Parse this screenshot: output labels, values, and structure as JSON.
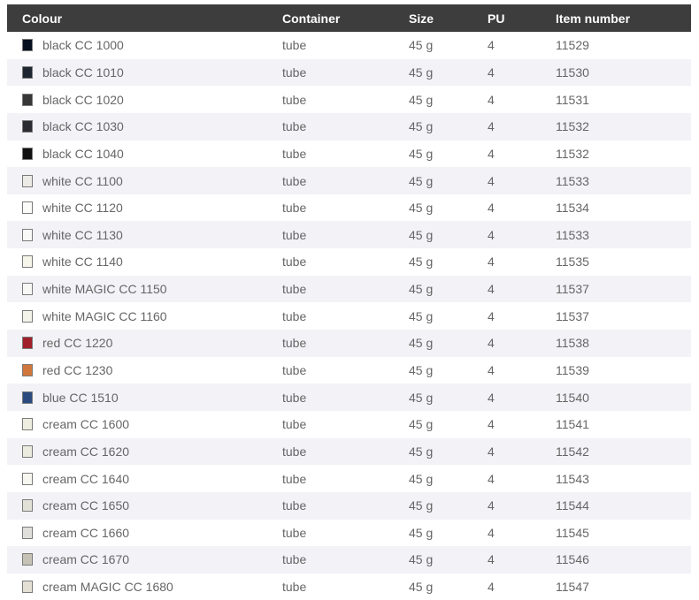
{
  "header": {
    "colour": "Colour",
    "container": "Container",
    "size": "Size",
    "pu": "PU",
    "item_number": "Item number"
  },
  "rows": [
    {
      "colour": "black CC 1000",
      "swatch": "#07101e",
      "container": "tube",
      "size": "45 g",
      "pu": "4",
      "item": "11529"
    },
    {
      "colour": "black CC 1010",
      "swatch": "#1d2630",
      "container": "tube",
      "size": "45 g",
      "pu": "4",
      "item": "11530"
    },
    {
      "colour": "black CC 1020",
      "swatch": "#373737",
      "container": "tube",
      "size": "45 g",
      "pu": "4",
      "item": "11531"
    },
    {
      "colour": "black CC 1030",
      "swatch": "#2a2a31",
      "container": "tube",
      "size": "45 g",
      "pu": "4",
      "item": "11532"
    },
    {
      "colour": "black CC 1040",
      "swatch": "#111111",
      "container": "tube",
      "size": "45 g",
      "pu": "4",
      "item": "11532"
    },
    {
      "colour": "white CC 1100",
      "swatch": "#ecebe6",
      "container": "tube",
      "size": "45 g",
      "pu": "4",
      "item": "11533"
    },
    {
      "colour": "white CC 1120",
      "swatch": "#fbfbfa",
      "container": "tube",
      "size": "45 g",
      "pu": "4",
      "item": "11534"
    },
    {
      "colour": "white CC 1130",
      "swatch": "#f9f9f7",
      "container": "tube",
      "size": "45 g",
      "pu": "4",
      "item": "11533"
    },
    {
      "colour": "white CC 1140",
      "swatch": "#f6f6ea",
      "container": "tube",
      "size": "45 g",
      "pu": "4",
      "item": "11535"
    },
    {
      "colour": "white MAGIC CC 1150",
      "swatch": "#f8f8f6",
      "container": "tube",
      "size": "45 g",
      "pu": "4",
      "item": "11537"
    },
    {
      "colour": "white MAGIC CC 1160",
      "swatch": "#f3f3ea",
      "container": "tube",
      "size": "45 g",
      "pu": "4",
      "item": "11537"
    },
    {
      "colour": "red CC 1220",
      "swatch": "#a01f2b",
      "container": "tube",
      "size": "45 g",
      "pu": "4",
      "item": "11538"
    },
    {
      "colour": "red CC 1230",
      "swatch": "#d2773b",
      "container": "tube",
      "size": "45 g",
      "pu": "4",
      "item": "11539"
    },
    {
      "colour": "blue CC 1510",
      "swatch": "#2b4a7e",
      "container": "tube",
      "size": "45 g",
      "pu": "4",
      "item": "11540"
    },
    {
      "colour": "cream CC 1600",
      "swatch": "#eeeee0",
      "container": "tube",
      "size": "45 g",
      "pu": "4",
      "item": "11541"
    },
    {
      "colour": "cream CC 1620",
      "swatch": "#ebebe0",
      "container": "tube",
      "size": "45 g",
      "pu": "4",
      "item": "11542"
    },
    {
      "colour": "cream CC 1640",
      "swatch": "#f7f7f0",
      "container": "tube",
      "size": "45 g",
      "pu": "4",
      "item": "11543"
    },
    {
      "colour": "cream CC 1650",
      "swatch": "#e2e1d8",
      "container": "tube",
      "size": "45 g",
      "pu": "4",
      "item": "11544"
    },
    {
      "colour": "cream CC 1660",
      "swatch": "#e0dfdc",
      "container": "tube",
      "size": "45 g",
      "pu": "4",
      "item": "11545"
    },
    {
      "colour": "cream CC 1670",
      "swatch": "#c6c3b6",
      "container": "tube",
      "size": "45 g",
      "pu": "4",
      "item": "11546"
    },
    {
      "colour": "cream MAGIC CC 1680",
      "swatch": "#e4e0d4",
      "container": "tube",
      "size": "45 g",
      "pu": "4",
      "item": "11547"
    }
  ],
  "style": {
    "header_bg": "#3d3d3d",
    "alt_row_bg": "#f2f2f7",
    "text_color": "#666666"
  }
}
